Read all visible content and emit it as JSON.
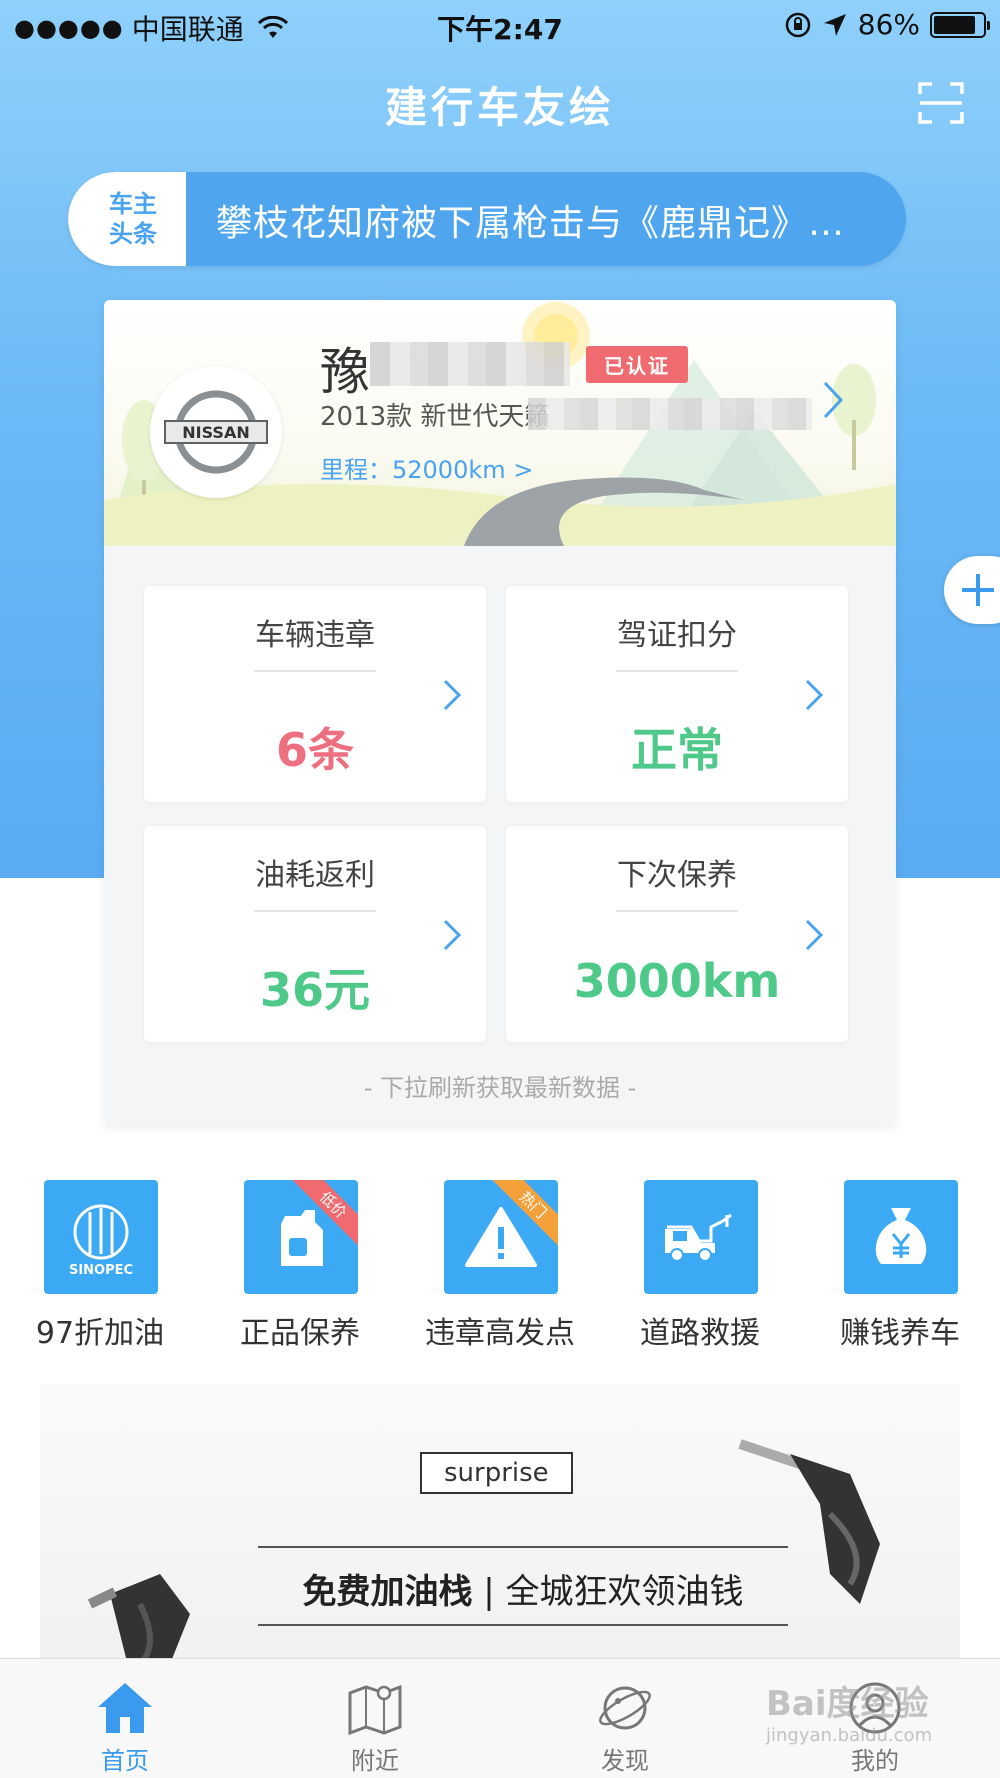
{
  "status_bar": {
    "signal": "●●●●●",
    "carrier": "中国联通",
    "time": "下午2:47",
    "battery": "86%",
    "battery_level": 0.86
  },
  "header": {
    "title": "建行车友绘",
    "scan_icon": "scan-icon"
  },
  "news": {
    "tag_line1": "车主",
    "tag_line2": "头条",
    "text": "攀枝花知府被下属枪击与《鹿鼎记》…"
  },
  "vehicle": {
    "plate_prefix": "豫",
    "verified": "已认证",
    "model": "2013款 新世代天籟",
    "mileage": "里程：52000km >",
    "brand_logo_text": "NISSAN"
  },
  "stats": [
    {
      "title": "车辆违章",
      "value": "6条",
      "color": "#ee6f80"
    },
    {
      "title": "驾证扣分",
      "value": "正常",
      "color": "#4fc98a"
    },
    {
      "title": "油耗返利",
      "value": "36元",
      "color": "#4fc98a"
    },
    {
      "title": "下次保养",
      "value": "3000km",
      "color": "#4fc98a"
    }
  ],
  "refresh_hint": "- 下拉刷新获取最新数据 -",
  "services": [
    {
      "label": "97折加油",
      "icon": "sinopec-icon",
      "badge": ""
    },
    {
      "label": "正品保养",
      "icon": "oil-bottle-icon",
      "badge": "低价"
    },
    {
      "label": "违章高发点",
      "icon": "warning-icon",
      "badge": "热门"
    },
    {
      "label": "道路救援",
      "icon": "tow-truck-icon",
      "badge": ""
    },
    {
      "label": "赚钱养车",
      "icon": "money-bag-icon",
      "badge": ""
    }
  ],
  "service_logo_text": "SINOPEC",
  "banner": {
    "surprise": "surprise",
    "headline_bold": "免费加油栈",
    "headline_sep": "|",
    "headline_rest": "全城狂欢领油钱"
  },
  "tabs": [
    {
      "label": "首页",
      "icon": "home-icon",
      "active": true
    },
    {
      "label": "附近",
      "icon": "map-icon",
      "active": false
    },
    {
      "label": "发现",
      "icon": "planet-icon",
      "active": false
    },
    {
      "label": "我的",
      "icon": "user-icon",
      "active": false
    }
  ],
  "watermark": {
    "main": "Bai度经验",
    "sub": "jingyan.baidu.com"
  },
  "colors": {
    "accent": "#3a9bee",
    "hero": "#6cbaf6",
    "service": "#3ba9f4",
    "badge_red": "#f06b6f",
    "badge_orange": "#f4a13c"
  }
}
